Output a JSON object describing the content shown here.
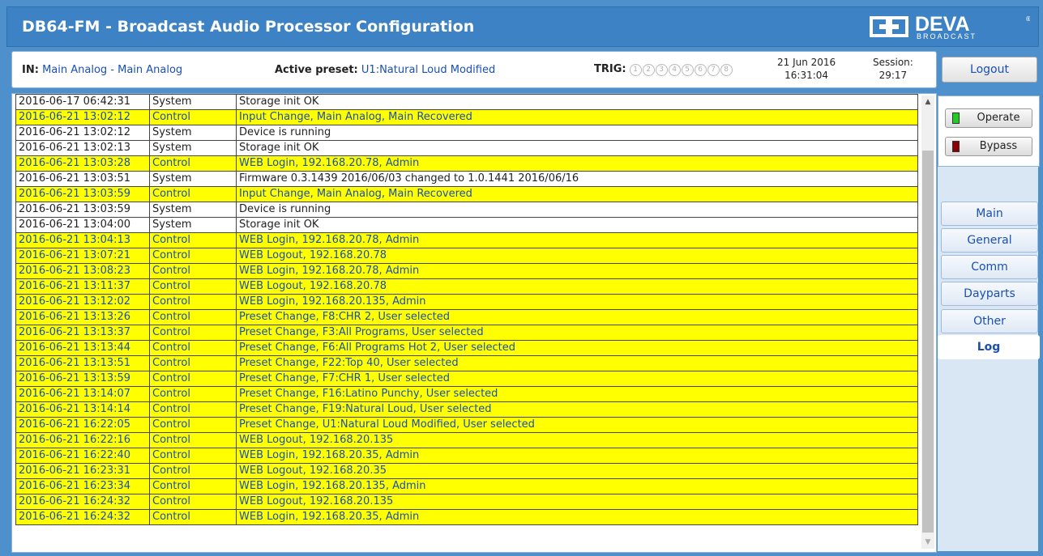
{
  "header": {
    "title": "DB64-FM - Broadcast Audio Processor Configuration",
    "logo_text": "DEVA",
    "logo_sub": "BROADCAST"
  },
  "info": {
    "in_label": "IN:",
    "in_value": "Main Analog - Main Analog",
    "preset_label": "Active preset:",
    "preset_value": "U1:Natural Loud Modified",
    "trig_label": "TRIG:",
    "trig_items": [
      "1",
      "2",
      "3",
      "4",
      "5",
      "6",
      "7",
      "8"
    ],
    "date": "21 Jun 2016",
    "time": "16:31:04",
    "session_label": "Session:",
    "session_value": "29:17"
  },
  "buttons": {
    "logout": "Logout",
    "operate": "Operate",
    "bypass": "Bypass"
  },
  "nav": [
    "Main",
    "General",
    "Comm",
    "Dayparts",
    "Other",
    "Log"
  ],
  "colors": {
    "control_row": "#ffff00",
    "link_blue": "#1a4fb5",
    "operate_led": "#22cc22",
    "bypass_led": "#8b0000"
  },
  "log": [
    [
      "2016-06-17 06:42:31",
      "System",
      "Storage init OK"
    ],
    [
      "2016-06-21 13:02:12",
      "Control",
      "Input Change, Main Analog, Main Recovered"
    ],
    [
      "2016-06-21 13:02:12",
      "System",
      "Device is running"
    ],
    [
      "2016-06-21 13:02:13",
      "System",
      "Storage init OK"
    ],
    [
      "2016-06-21 13:03:28",
      "Control",
      "WEB Login, 192.168.20.78, Admin"
    ],
    [
      "2016-06-21 13:03:51",
      "System",
      "Firmware 0.3.1439 2016/06/03 changed to 1.0.1441 2016/06/16"
    ],
    [
      "2016-06-21 13:03:59",
      "Control",
      "Input Change, Main Analog, Main Recovered"
    ],
    [
      "2016-06-21 13:03:59",
      "System",
      "Device is running"
    ],
    [
      "2016-06-21 13:04:00",
      "System",
      "Storage init OK"
    ],
    [
      "2016-06-21 13:04:13",
      "Control",
      "WEB Login, 192.168.20.78, Admin"
    ],
    [
      "2016-06-21 13:07:21",
      "Control",
      "WEB Logout, 192.168.20.78"
    ],
    [
      "2016-06-21 13:08:23",
      "Control",
      "WEB Login, 192.168.20.78, Admin"
    ],
    [
      "2016-06-21 13:11:37",
      "Control",
      "WEB Logout, 192.168.20.78"
    ],
    [
      "2016-06-21 13:12:02",
      "Control",
      "WEB Login, 192.168.20.135, Admin"
    ],
    [
      "2016-06-21 13:13:26",
      "Control",
      "Preset Change, F8:CHR 2, User selected"
    ],
    [
      "2016-06-21 13:13:37",
      "Control",
      "Preset Change, F3:All Programs, User selected"
    ],
    [
      "2016-06-21 13:13:44",
      "Control",
      "Preset Change, F6:All Programs Hot 2, User selected"
    ],
    [
      "2016-06-21 13:13:51",
      "Control",
      "Preset Change, F22:Top 40, User selected"
    ],
    [
      "2016-06-21 13:13:59",
      "Control",
      "Preset Change, F7:CHR 1, User selected"
    ],
    [
      "2016-06-21 13:14:07",
      "Control",
      "Preset Change, F16:Latino Punchy, User selected"
    ],
    [
      "2016-06-21 13:14:14",
      "Control",
      "Preset Change, F19:Natural Loud, User selected"
    ],
    [
      "2016-06-21 16:22:05",
      "Control",
      "Preset Change, U1:Natural Loud Modified, User selected"
    ],
    [
      "2016-06-21 16:22:16",
      "Control",
      "WEB Logout, 192.168.20.135"
    ],
    [
      "2016-06-21 16:22:40",
      "Control",
      "WEB Login, 192.168.20.35, Admin"
    ],
    [
      "2016-06-21 16:23:31",
      "Control",
      "WEB Logout, 192.168.20.35"
    ],
    [
      "2016-06-21 16:23:34",
      "Control",
      "WEB Login, 192.168.20.135, Admin"
    ],
    [
      "2016-06-21 16:24:32",
      "Control",
      "WEB Logout, 192.168.20.135"
    ],
    [
      "2016-06-21 16:24:32",
      "Control",
      "WEB Login, 192.168.20.35, Admin"
    ]
  ]
}
